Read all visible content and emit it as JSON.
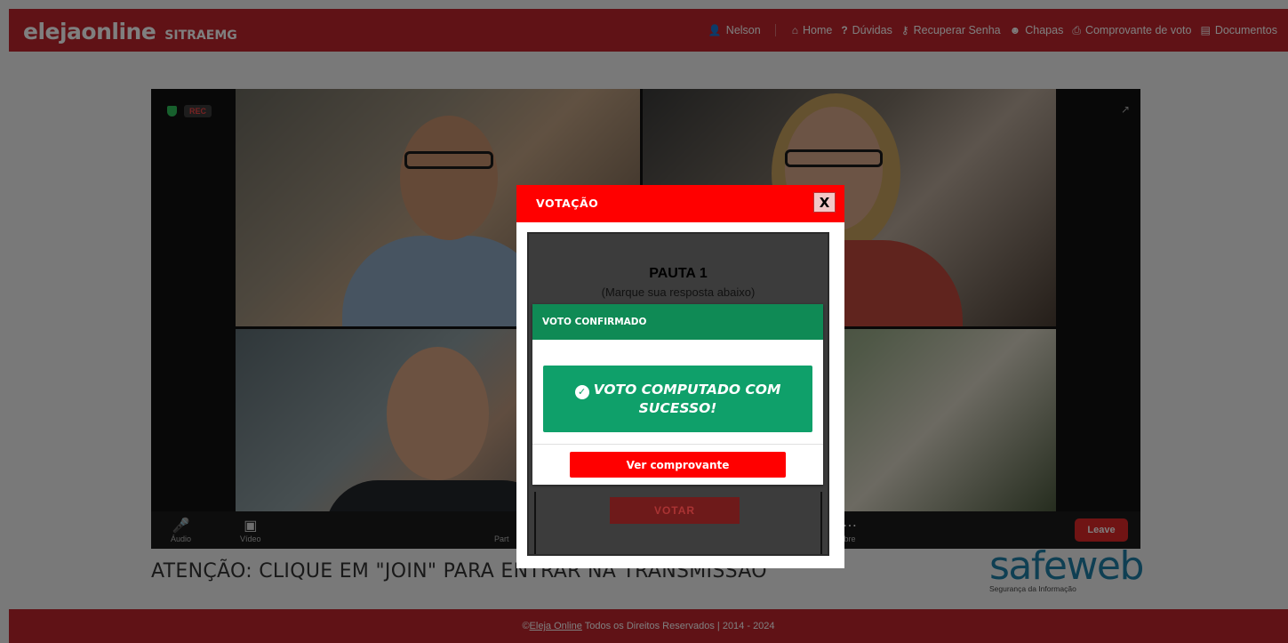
{
  "colors": {
    "brand_red": "#c0242c",
    "modal_header_red": "#ff0000",
    "confirm_green": "#0f8a55",
    "success_green": "#0fa06a",
    "safeweb_blue": "#1e7fa6"
  },
  "header": {
    "logo_text": "elejaonline",
    "org": "SITRAEMG",
    "user": "Nelson",
    "nav": [
      {
        "label": "Home",
        "icon": "home-icon"
      },
      {
        "label": "Dúvidas",
        "icon": "question-icon"
      },
      {
        "label": "Recuperar Senha",
        "icon": "key-icon"
      },
      {
        "label": "Chapas",
        "icon": "users-icon"
      },
      {
        "label": "Comprovante de voto",
        "icon": "printer-icon"
      },
      {
        "label": "Documentos",
        "icon": "document-icon"
      }
    ]
  },
  "video": {
    "rec_label": "REC",
    "controls": [
      {
        "label": "Áudio",
        "icon": "microphone-icon"
      },
      {
        "label": "Vídeo",
        "icon": "camera-icon"
      },
      {
        "label": "Part",
        "icon": "participants-icon"
      },
      {
        "label": "bre",
        "icon": "more-icon"
      }
    ],
    "leave_label": "Leave"
  },
  "notice": "ATENÇÃO: CLIQUE EM \"JOIN\" PARA ENTRAR NA TRANSMISSÃO",
  "sponsor": {
    "logo_text": "safeweb",
    "tagline": "Segurança da Informação"
  },
  "footer": {
    "copyright_prefix": "©",
    "link": "Eleja Online",
    "rest": " Todos os Direitos Reservados | 2014 - 2024"
  },
  "modal": {
    "title": "VOTAÇÃO",
    "close_label": "X",
    "pauta_title": "PAUTA 1",
    "pauta_instruction": "(Marque sua resposta abaixo)",
    "votar_label": "VOTAR",
    "confirmation": {
      "header": "VOTO CONFIRMADO",
      "message": "VOTO COMPUTADO COM SUCESSO!",
      "button": "Ver comprovante"
    }
  }
}
